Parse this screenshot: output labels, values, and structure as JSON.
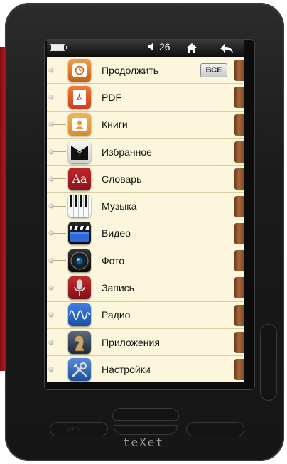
{
  "status": {
    "volume": "26"
  },
  "all_button": "ВСЕ",
  "menu": [
    {
      "label": "Продолжить",
      "icon": "continue-icon"
    },
    {
      "label": "PDF",
      "icon": "pdf-icon"
    },
    {
      "label": "Книги",
      "icon": "books-icon"
    },
    {
      "label": "Избранное",
      "icon": "favorites-icon"
    },
    {
      "label": "Словарь",
      "icon": "dictionary-icon"
    },
    {
      "label": "Музыка",
      "icon": "music-icon"
    },
    {
      "label": "Видео",
      "icon": "video-icon"
    },
    {
      "label": "Фото",
      "icon": "photo-icon"
    },
    {
      "label": "Запись",
      "icon": "recording-icon"
    },
    {
      "label": "Радио",
      "icon": "radio-icon"
    },
    {
      "label": "Приложения",
      "icon": "apps-icon"
    },
    {
      "label": "Настройки",
      "icon": "settings-icon"
    }
  ],
  "hardware": {
    "menu_label": "MENU",
    "brand": "teXet"
  }
}
